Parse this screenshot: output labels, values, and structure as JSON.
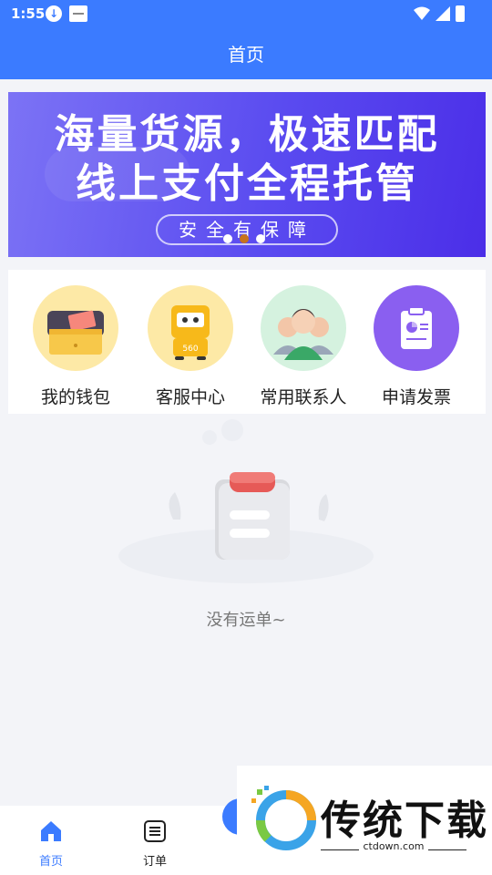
{
  "status_bar": {
    "time": "1:55"
  },
  "header": {
    "title": "首页"
  },
  "banner": {
    "line1": "海量货源，极速匹配",
    "line2": "线上支付全程托管",
    "pill": "安全有保障",
    "active_dot": 1,
    "dot_count": 3
  },
  "actions": [
    {
      "label": "我的钱包",
      "icon": "wallet-icon"
    },
    {
      "label": "客服中心",
      "icon": "service-robot-icon"
    },
    {
      "label": "常用联系人",
      "icon": "contacts-icon"
    },
    {
      "label": "申请发票",
      "icon": "invoice-icon"
    }
  ],
  "empty_state": {
    "text": "没有运单~",
    "icon": "empty-clipboard-icon"
  },
  "tabbar": {
    "items": [
      {
        "label": "首页",
        "icon": "home-icon",
        "active": true
      },
      {
        "label": "订单",
        "icon": "order-list-icon",
        "active": false
      }
    ]
  },
  "watermark": {
    "brand": "传统下载",
    "domain": "ctdown.com"
  },
  "colors": {
    "primary": "#3b7bff",
    "banner_start": "#7c73f5",
    "banner_end": "#4b2ee8",
    "accent_dot": "#c8731c",
    "invoice": "#8a5ff0"
  }
}
